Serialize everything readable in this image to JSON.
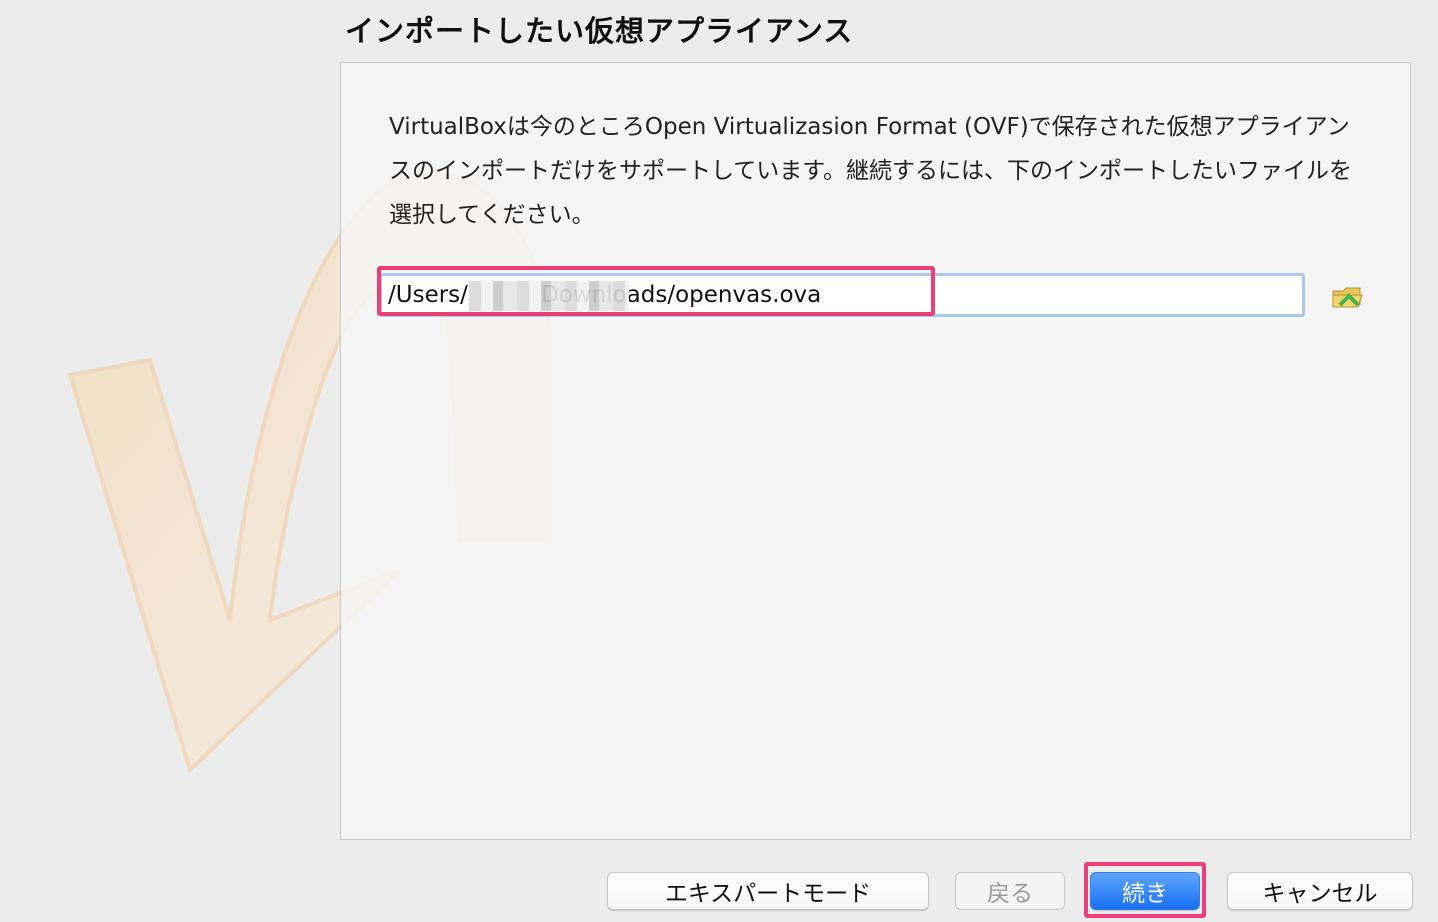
{
  "wizard": {
    "title": "インポートしたい仮想アプライアンス",
    "description": "VirtualBoxは今のところOpen Virtualizasion Format (OVF)で保存された仮想アプライアンスのインポートだけをサポートしています。継続するには、下のインポートしたいファイルを選択してください。",
    "file_path": {
      "prefix": "/Users/",
      "suffix": "Downloads/openvas.ova",
      "value": "/Users/          Downloads/openvas.ova"
    },
    "folder_icon": "folder-open-icon",
    "buttons": {
      "expert_mode": "エキスパートモード",
      "back": "戻る",
      "next": "続き",
      "cancel": "キャンセル"
    }
  },
  "colors": {
    "highlight": "#ee3e78",
    "primary_button": "#1a70f4",
    "field_focus_border": "#a9c8ec",
    "background": "#ececec"
  }
}
